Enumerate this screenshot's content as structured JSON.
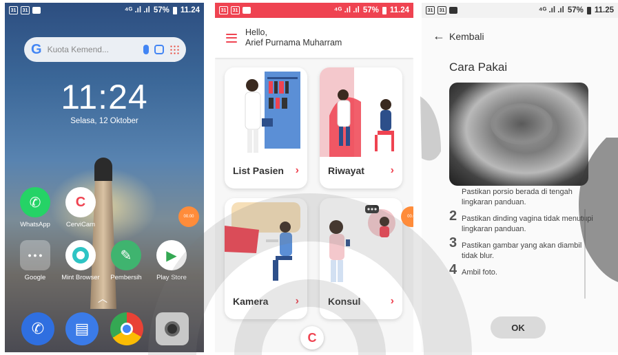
{
  "screen1": {
    "status": {
      "signal": "⁴ᴳ .ıl .ıl",
      "battery": "57%",
      "time": "11.24"
    },
    "search": {
      "placeholder": "Kuota Kemend...",
      "logo": "G"
    },
    "clock": "11:24",
    "date": "Selasa, 12 Oktober",
    "apps": [
      {
        "label": "WhatsApp",
        "icon": "whatsapp-icon",
        "color": "#25d366"
      },
      {
        "label": "CerviCam",
        "icon": "cervicam-icon",
        "color": "#ffffff"
      },
      {
        "label": "Google",
        "icon": "folder-icon",
        "color": "#ffffff"
      },
      {
        "label": "Mint Browser",
        "icon": "mint-browser-icon",
        "color": "#2ec4c4"
      },
      {
        "label": "Pembersih",
        "icon": "cleaner-icon",
        "color": "#3fb46f"
      },
      {
        "label": "Play Store",
        "icon": "play-store-icon",
        "color": "#ffffff"
      }
    ],
    "floating_badge": "00.00",
    "dock": [
      "phone-icon",
      "messages-icon",
      "chrome-icon",
      "camera-icon"
    ]
  },
  "screen2": {
    "status": {
      "signal": "⁴ᴳ .ıl .ıl",
      "battery": "57%",
      "time": "11.24"
    },
    "greeting": "Hello,",
    "user_name": "Arief Purnama Muharram",
    "cards": [
      {
        "label": "List Pasien",
        "arrow": "›"
      },
      {
        "label": "Riwayat",
        "arrow": "›"
      },
      {
        "label": "Kamera",
        "arrow": "›"
      },
      {
        "label": "Konsul",
        "arrow": "›"
      }
    ],
    "floating_badge": "00.0",
    "logo": "C",
    "accent": "#ef4351"
  },
  "screen3": {
    "status": {
      "signal": "⁴ᴳ .ıl .ıl",
      "battery": "57%",
      "time": "11.25"
    },
    "back_label": "Kembali",
    "title": "Cara Pakai",
    "step1_tail": "Pastikan porsio berada di tengah lingkaran panduan.",
    "steps": [
      {
        "num": "2",
        "text": "Pastikan dinding vagina tidak menutupi lingkaran panduan."
      },
      {
        "num": "3",
        "text": "Pastikan gambar yang akan diambil tidak blur."
      },
      {
        "num": "4",
        "text": "Ambil foto."
      }
    ],
    "ok_label": "OK"
  }
}
